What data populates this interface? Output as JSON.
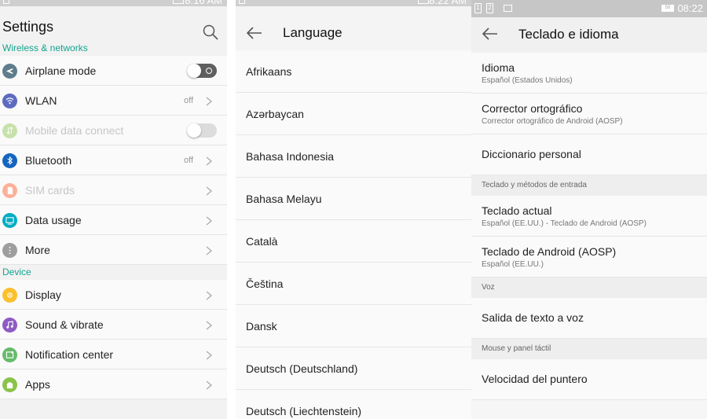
{
  "panel1": {
    "status_time": "8:16 AM",
    "title": "Settings",
    "sections": [
      {
        "title": "Wireless & networks",
        "items": [
          {
            "label": "Airplane mode",
            "icon": "airplane-icon",
            "color": "#607d8b",
            "control": "toggle-on"
          },
          {
            "label": "WLAN",
            "icon": "wifi-icon",
            "color": "#5c6bc0",
            "value": "off",
            "control": "chevron"
          },
          {
            "label": "Mobile data connect",
            "icon": "mobile-data-icon",
            "color": "#8bc34a",
            "control": "toggle-off",
            "disabled": true
          },
          {
            "label": "Bluetooth",
            "icon": "bluetooth-icon",
            "color": "#1565c0",
            "value": "off",
            "control": "chevron"
          },
          {
            "label": "SIM cards",
            "icon": "sim-card-icon",
            "color": "#ff5722",
            "control": "chevron",
            "disabled": true
          },
          {
            "label": "Data usage",
            "icon": "data-usage-icon",
            "color": "#00acc1",
            "control": "chevron"
          },
          {
            "label": "More",
            "icon": "more-icon",
            "color": "#9e9e9e",
            "control": "chevron"
          }
        ]
      },
      {
        "title": "Device",
        "items": [
          {
            "label": "Display",
            "icon": "display-icon",
            "color": "#fbc02d",
            "control": "chevron"
          },
          {
            "label": "Sound & vibrate",
            "icon": "sound-icon",
            "color": "#8e5bc4",
            "control": "chevron"
          },
          {
            "label": "Notification center",
            "icon": "notification-icon",
            "color": "#66bb6a",
            "control": "chevron"
          },
          {
            "label": "Apps",
            "icon": "apps-icon",
            "color": "#8bc34a",
            "control": "chevron"
          }
        ]
      }
    ]
  },
  "panel2": {
    "status_time": "8:22 AM",
    "title": "Language",
    "languages": [
      "Afrikaans",
      "Azərbaycan",
      "Bahasa Indonesia",
      "Bahasa Melayu",
      "Català",
      "Čeština",
      "Dansk",
      "Deutsch (Deutschland)",
      "Deutsch (Liechtenstein)"
    ]
  },
  "panel3": {
    "status_time": "08:22",
    "battery_level": "58",
    "title": "Teclado e idioma",
    "items": [
      {
        "kind": "item",
        "title": "Idioma",
        "subtitle": "Español (Estados Unidos)"
      },
      {
        "kind": "item",
        "title": "Corrector ortográfico",
        "subtitle": "Corrector ortográfico de Android (AOSP)"
      },
      {
        "kind": "item",
        "title": "Diccionario personal"
      },
      {
        "kind": "header",
        "title": "Teclado y métodos de entrada"
      },
      {
        "kind": "item",
        "title": "Teclado actual",
        "subtitle": "Español (EE.UU.) - Teclado de Android (AOSP)"
      },
      {
        "kind": "item",
        "title": "Teclado de Android (AOSP)",
        "subtitle": "Español (EE.UU.)"
      },
      {
        "kind": "header",
        "title": "Voz"
      },
      {
        "kind": "item",
        "title": "Salida de texto a voz"
      },
      {
        "kind": "header",
        "title": "Mouse y panel táctil"
      },
      {
        "kind": "item",
        "title": "Velocidad del puntero"
      }
    ]
  }
}
